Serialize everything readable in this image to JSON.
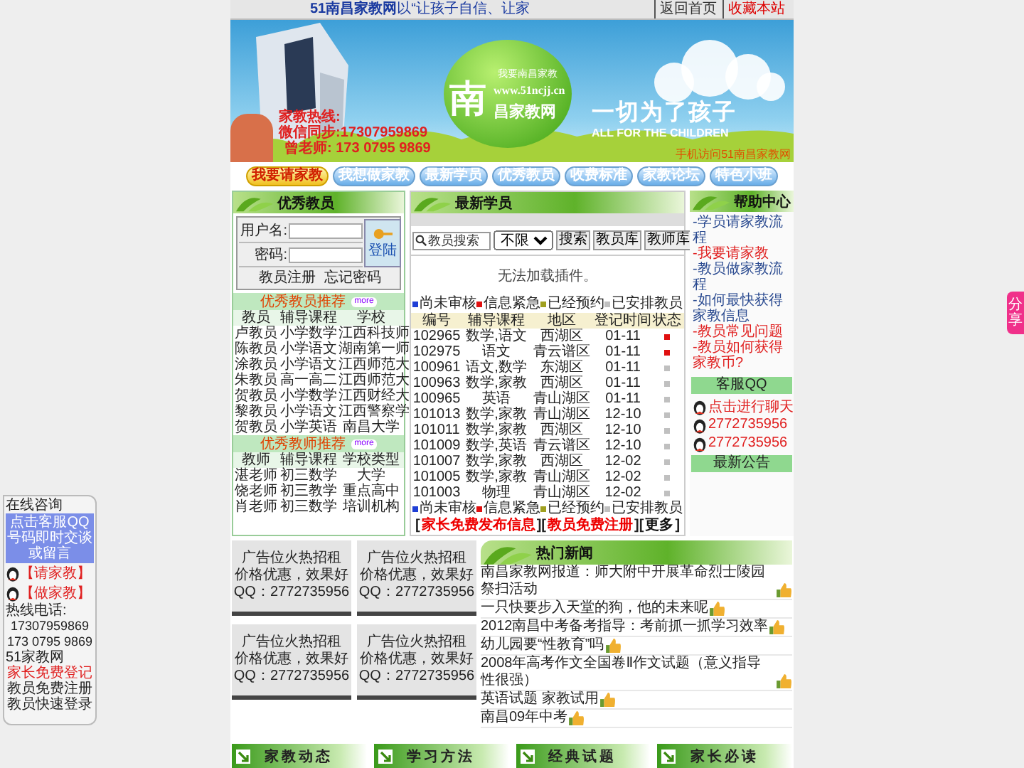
{
  "top_bar": {
    "site": "51南昌家教网",
    "slogan": "以“让孩子自信、让家",
    "links": [
      "返回首页",
      "收藏本站"
    ]
  },
  "banner": {
    "logo_small": "我要南昌家教",
    "url": "www.51ncjj.cn",
    "logo_big": "南",
    "logo_name": "昌家教网",
    "slogan": "一切为了孩子",
    "slogan_en": "ALL FOR THE CHILDREN",
    "hotline": [
      "家教热线:",
      "微信同步:17307959869",
      "曾老师: 173 0795 9869"
    ],
    "mobile": "手机访问51南昌家教网"
  },
  "nav": [
    {
      "label": "我要请家教",
      "selected": true
    },
    {
      "label": "我想做家教",
      "selected": false
    },
    {
      "label": "最新学员",
      "selected": false
    },
    {
      "label": "优秀教员",
      "selected": false
    },
    {
      "label": "收费标准",
      "selected": false
    },
    {
      "label": "家教论坛",
      "selected": false
    },
    {
      "label": "特色小班",
      "selected": false
    }
  ],
  "left": {
    "title": "优秀教员",
    "login": {
      "user_label": "用户名:",
      "pass_label": "密码:",
      "button": "登陆",
      "links": [
        "教员注册",
        "忘记密码"
      ]
    },
    "tutor_rec": {
      "title": "优秀教员推荐",
      "badge": "more",
      "columns": [
        "教员",
        "辅导课程",
        "学校"
      ],
      "rows": [
        [
          "卢教员",
          "小学数学",
          "江西科技师"
        ],
        [
          "陈教员",
          "小学语文",
          "湖南第一师"
        ],
        [
          "涂教员",
          "小学语文",
          "江西师范大"
        ],
        [
          "朱教员",
          "高一高二",
          "江西师范大"
        ],
        [
          "贺教员",
          "小学数学",
          "江西财经大"
        ],
        [
          "黎教员",
          "小学语文",
          "江西警察学"
        ],
        [
          "贺教员",
          "小学英语",
          "南昌大学"
        ]
      ]
    },
    "teacher_rec": {
      "title": "优秀教师推荐",
      "badge": "more",
      "columns": [
        "教师",
        "辅导课程",
        "学校类型"
      ],
      "rows": [
        [
          "湛老师",
          "初三数学",
          "大学"
        ],
        [
          "饶老师",
          "初三教学",
          "重点高中"
        ],
        [
          "肖老师",
          "初三数学",
          "培训机构"
        ]
      ]
    }
  },
  "center": {
    "title": "最新学员",
    "search": {
      "placeholder": "教员搜索",
      "select": "不限",
      "button": "搜索",
      "tabs": [
        "教员库",
        "教师库"
      ]
    },
    "plugin_msg": "无法加载插件。",
    "legend": [
      {
        "label": "尚未审核",
        "color": "#1f3fd6"
      },
      {
        "label": "信息紧急",
        "color": "#e01010"
      },
      {
        "label": "已经预约",
        "color": "#a0a020"
      },
      {
        "label": "已安排教员",
        "color": "#c0c0c0"
      }
    ],
    "columns": [
      "编号",
      "辅导课程",
      "地区",
      "登记时间",
      "状态"
    ],
    "rows": [
      {
        "cells": [
          "102965",
          "数学,语文",
          "西湖区",
          "01-11"
        ],
        "color": "#e01010"
      },
      {
        "cells": [
          "102975",
          "语文",
          "青云谱区",
          "01-11"
        ],
        "color": "#e01010"
      },
      {
        "cells": [
          "100961",
          "语文,数学",
          "东湖区",
          "01-11"
        ],
        "color": "#c0c0c0"
      },
      {
        "cells": [
          "100963",
          "数学,家教",
          "西湖区",
          "01-11"
        ],
        "color": "#c0c0c0"
      },
      {
        "cells": [
          "100965",
          "英语",
          "青山湖区",
          "01-11"
        ],
        "color": "#c0c0c0"
      },
      {
        "cells": [
          "101013",
          "数学,家教",
          "青山湖区",
          "12-10"
        ],
        "color": "#c0c0c0"
      },
      {
        "cells": [
          "101011",
          "数学,家教",
          "西湖区",
          "12-10"
        ],
        "color": "#c0c0c0"
      },
      {
        "cells": [
          "101009",
          "数学,英语",
          "青云谱区",
          "12-10"
        ],
        "color": "#c0c0c0"
      },
      {
        "cells": [
          "101007",
          "数学,家教",
          "西湖区",
          "12-02"
        ],
        "color": "#c0c0c0"
      },
      {
        "cells": [
          "101005",
          "数学,家教",
          "青山湖区",
          "12-02"
        ],
        "color": "#c0c0c0"
      },
      {
        "cells": [
          "101003",
          "物理",
          "青山湖区",
          "12-02"
        ],
        "color": "#c0c0c0"
      }
    ],
    "legend_bottom": [
      {
        "label": "尚未审核",
        "color": "#1f3fd6"
      },
      {
        "label": "信息紧急",
        "color": "#e01010"
      },
      {
        "label": "已经预约",
        "color": "#a0a020"
      },
      {
        "label": "已安排教员",
        "color": "#c0c0c0"
      }
    ],
    "links": [
      {
        "open": "[",
        "label": "家长免费发布信息",
        "close": "]",
        "kind": "hot"
      },
      {
        "open": "[",
        "label": "教员免费注册",
        "close": "]",
        "kind": "hot"
      },
      {
        "open": "[",
        "label": "更多",
        "close": "]",
        "kind": "plain"
      }
    ]
  },
  "right": {
    "title": "帮助中心",
    "links": [
      {
        "label": "-学员请家教流程",
        "kind": "normal"
      },
      {
        "label": "-我要请家教",
        "kind": "hot"
      },
      {
        "label": "-教员做家教流程",
        "kind": "normal"
      },
      {
        "label": "-如何最快获得家教信息",
        "kind": "normal"
      },
      {
        "label": "-教员常见问题",
        "kind": "hot"
      },
      {
        "label": "-教员如何获得家教币?",
        "kind": "hot"
      }
    ],
    "qq_title": "客服QQ",
    "qq": [
      "点击进行聊天",
      "2772735956",
      "2772735956"
    ],
    "notice_title": "最新公告"
  },
  "ads": [
    {
      "lines": [
        "广告位火热招租",
        "价格优惠，效果好",
        "QQ：2772735956"
      ]
    },
    {
      "lines": [
        "广告位火热招租",
        "价格优惠，效果好",
        "QQ：2772735956"
      ]
    },
    {
      "lines": [
        "广告位火热招租",
        "价格优惠，效果好",
        "QQ：2772735956"
      ]
    },
    {
      "lines": [
        "广告位火热招租",
        "价格优惠，效果好",
        "QQ：2772735956"
      ]
    }
  ],
  "news": {
    "title": "热门新闻",
    "items": [
      "南昌家教网报道：师大附中开展革命烈士陵园祭扫活动",
      "一只快要步入天堂的狗，他的未来呢",
      "2012南昌中考备考指导：考前抓一抓学习效率",
      "幼儿园要“性教育”吗",
      "2008年高考作文全国卷Ⅱ作文试题（意义指导性很强）",
      "英语试题 家教试用",
      "南昌09年中考"
    ]
  },
  "footer_tabs": [
    "家教动态",
    "学习方法",
    "经典试题",
    "家长必读"
  ],
  "float_left": {
    "title": "在线咨询",
    "notice": "点击客服QQ号码即时交谈或留言",
    "qq": [
      "【请家教】",
      "【做家教】"
    ],
    "hotline_label": "热线电话:",
    "phones": [
      "17307959869",
      "173 0795 9869"
    ],
    "site": "51家教网",
    "links": [
      {
        "label": "家长免费登记",
        "kind": "hot"
      },
      {
        "label": "教员免费注册",
        "kind": "normal"
      },
      {
        "label": "教员快速登录",
        "kind": "normal"
      }
    ]
  },
  "float_right": {
    "label": "分享"
  }
}
